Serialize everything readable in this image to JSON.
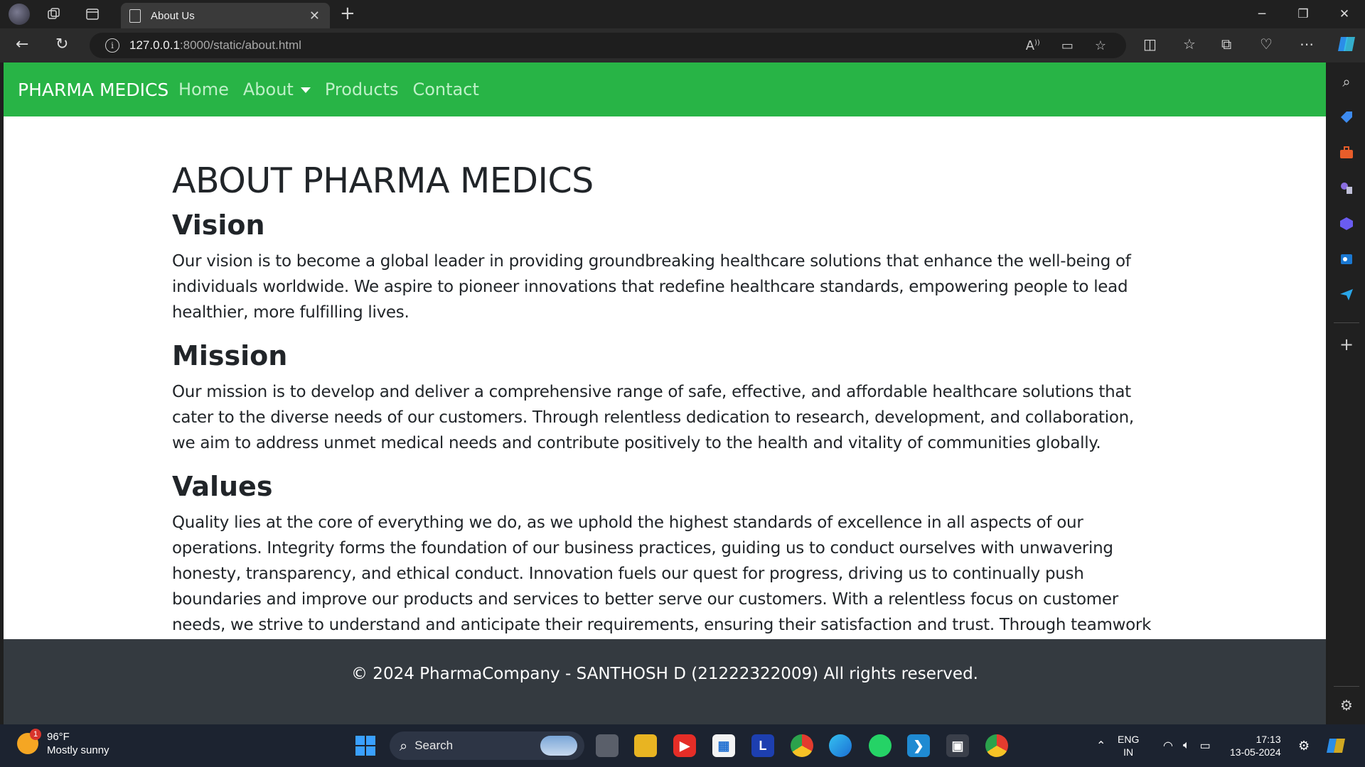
{
  "browser": {
    "tab_title": "About Us",
    "url_host": "127.0.0.1",
    "url_rest": ":8000/static/about.html"
  },
  "navbar": {
    "brand": "PHARMA MEDICS",
    "links": [
      "Home",
      "About",
      "Products",
      "Contact"
    ],
    "active": "About"
  },
  "main": {
    "title": "ABOUT PHARMA MEDICS",
    "sections": [
      {
        "heading": "Vision",
        "text": "Our vision is to become a global leader in providing groundbreaking healthcare solutions that enhance the well-being of individuals worldwide. We aspire to pioneer innovations that redefine healthcare standards, empowering people to lead healthier, more fulfilling lives."
      },
      {
        "heading": "Mission",
        "text": "Our mission is to develop and deliver a comprehensive range of safe, effective, and affordable healthcare solutions that cater to the diverse needs of our customers. Through relentless dedication to research, development, and collaboration, we aim to address unmet medical needs and contribute positively to the health and vitality of communities globally."
      },
      {
        "heading": "Values",
        "text": "Quality lies at the core of everything we do, as we uphold the highest standards of excellence in all aspects of our operations. Integrity forms the foundation of our business practices, guiding us to conduct ourselves with unwavering honesty, transparency, and ethical conduct. Innovation fuels our quest for progress, driving us to continually push boundaries and improve our products and services to better serve our customers. With a relentless focus on customer needs, we strive to understand and anticipate their requirements, ensuring their satisfaction and trust. Through teamwork and collaboration, we harness the collective talents and"
      }
    ]
  },
  "footer": {
    "text": "© 2024 PharmaCompany - SANTHOSH D (21222322009) All rights reserved."
  },
  "taskbar": {
    "weather_badge": "1",
    "temperature": "96°F",
    "condition": "Mostly sunny",
    "search_label": "Search",
    "lang_line1": "ENG",
    "lang_line2": "IN",
    "time": "17:13",
    "date": "13-05-2024"
  },
  "colors": {
    "navbar_bg": "#28b446",
    "footer_bg": "#343a40"
  }
}
